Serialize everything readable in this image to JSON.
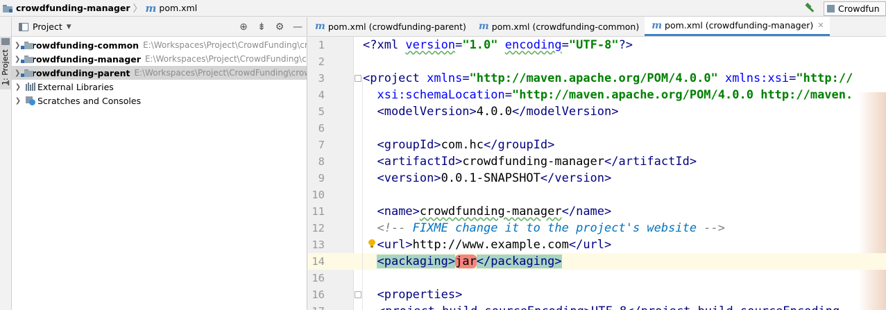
{
  "navbar": {
    "project_name": "crowdfunding-manager",
    "file_name": "pom.xml",
    "run_config": "Crowdfun"
  },
  "stripe": {
    "label_num": "1",
    "label_text": ": Project"
  },
  "project_panel": {
    "title": "Project",
    "items": [
      {
        "name": "crowdfunding-common",
        "path": "E:\\Workspaces\\Project\\CrowdFunding\\cr"
      },
      {
        "name": "crowdfunding-manager",
        "path": "E:\\Workspaces\\Project\\CrowdFunding\\cr"
      },
      {
        "name": "crowdfunding-parent",
        "path": "E:\\Workspaces\\Project\\CrowdFunding\\crow"
      },
      {
        "name": "External Libraries"
      },
      {
        "name": "Scratches and Consoles"
      }
    ]
  },
  "tabs": [
    {
      "label": "pom.xml (crowdfunding-parent)"
    },
    {
      "label": "pom.xml (crowdfunding-common)"
    },
    {
      "label": "pom.xml (crowdfunding-manager)"
    }
  ],
  "editor": {
    "line_numbers": [
      "1",
      "2",
      "3",
      "4",
      "5",
      "6",
      "7",
      "8",
      "9",
      "10",
      "11",
      "12",
      "13",
      "14",
      "16",
      "17"
    ],
    "current_line": "14",
    "xml_decl": {
      "open": "<?xml ",
      "version_attr": "version",
      "version_val": "\"1.0\"",
      "enc_attr": "encoding",
      "enc_val": "\"UTF-8\"",
      "close": "?>"
    },
    "project_open": {
      "tag": "<project ",
      "xmlns_attr": "xmlns",
      "xmlns_val": "\"http://maven.apache.org/POM/4.0.0\"",
      "xsi_attr": "xmlns:xsi",
      "xsi_val": "\"http://"
    },
    "schema_line": {
      "attr": "xsi:schemaLocation",
      "val": "\"http://maven.apache.org/POM/4.0.0 http://maven."
    },
    "model_version": "4.0.0",
    "group_id": "com.hc",
    "artifact_id": "crowdfunding-manager",
    "version": "0.0.1-SNAPSHOT",
    "name": "crowdfunding-manager",
    "comment_open": "<!-- ",
    "comment_text": "FIXME change it to the project's website",
    "comment_close": " -->",
    "url": "http://www.example.com",
    "packaging": "jar",
    "properties_tag": "properties",
    "line17_partial": "<project.build.sourceEncoding>UTF-8</project.build.sourceEncoding"
  }
}
